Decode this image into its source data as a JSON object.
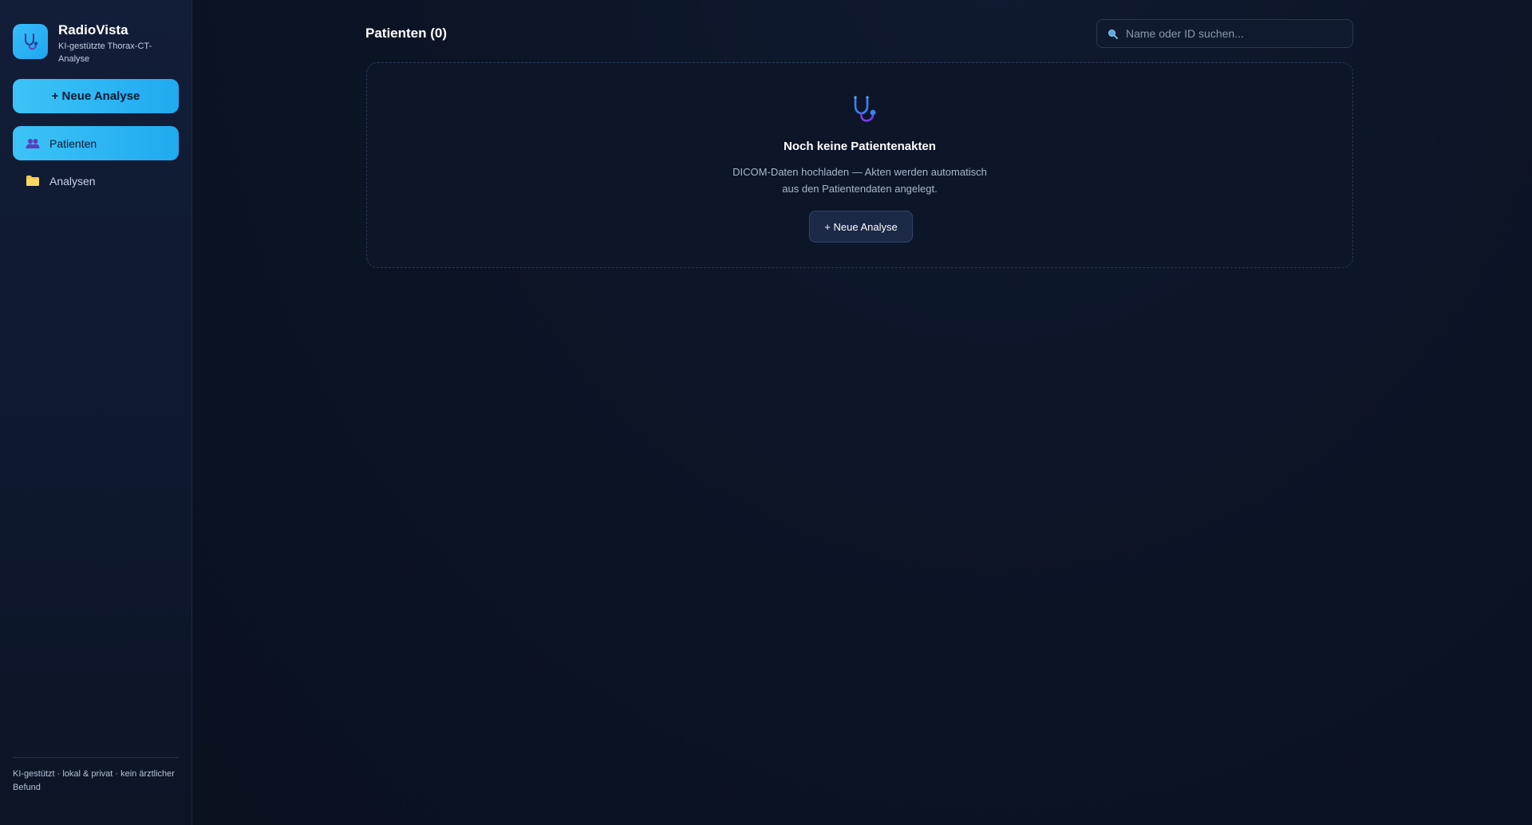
{
  "app": {
    "name": "RadioVista",
    "subtitle": "KI-gestützte Thorax-CT-Analyse",
    "logo_icon": "stethoscope-icon"
  },
  "sidebar": {
    "new_analysis_label": "+ Neue Analyse",
    "items": [
      {
        "label": "Patienten",
        "icon": "users-icon",
        "active": true
      },
      {
        "label": "Analysen",
        "icon": "folder-icon",
        "active": false
      }
    ],
    "footer": "KI-gestützt · lokal & privat · kein ärztlicher Befund"
  },
  "header": {
    "title": "Patienten (0)"
  },
  "search": {
    "placeholder": "Name oder ID suchen..."
  },
  "empty_state": {
    "icon": "stethoscope-icon",
    "title": "Noch keine Patientenakten",
    "description_line1": "DICOM-Daten hochladen — Akten werden automatisch",
    "description_line2": "aus den Patientendaten angelegt.",
    "button_label": "+ Neue Analyse"
  },
  "colors": {
    "accent": "#38bdf8",
    "background": "#0a1322",
    "sidebar": "#111c36"
  }
}
